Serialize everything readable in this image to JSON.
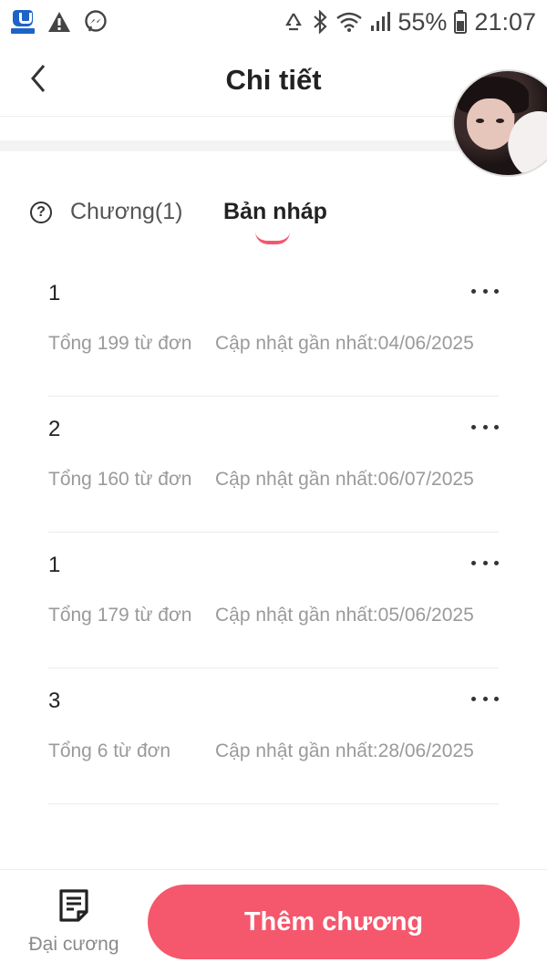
{
  "status_bar": {
    "battery": "55%",
    "time": "21:07",
    "icons": [
      "app-notification-icon",
      "warning-icon",
      "messenger-icon",
      "recycle-icon",
      "bluetooth-icon",
      "wifi-icon",
      "signal-icon",
      "battery-icon"
    ]
  },
  "header": {
    "title": "Chi tiết",
    "back_icon": "chevron-left-icon"
  },
  "tabs": {
    "chapters_label": "Chương(1)",
    "drafts_label": "Bản nháp",
    "active": "drafts",
    "help_icon": "question-circle-icon"
  },
  "drafts": [
    {
      "title": "1",
      "words": "Tổng 199 từ đơn",
      "updated": "Cập nhật gần nhất:04/06/2025"
    },
    {
      "title": "2",
      "words": "Tổng 160 từ đơn",
      "updated": "Cập nhật gần nhất:06/07/2025"
    },
    {
      "title": "1",
      "words": "Tổng 179 từ đơn",
      "updated": "Cập nhật gần nhất:05/06/2025"
    },
    {
      "title": "3",
      "words": "Tổng 6 từ đơn",
      "updated": "Cập nhật gần nhất:28/06/2025"
    }
  ],
  "bottom_bar": {
    "outline_label": "Đại cương",
    "outline_icon": "note-icon",
    "add_chapter_label": "Thêm chương"
  },
  "colors": {
    "accent": "#f5576c",
    "secondary_text": "#9a9a9a"
  }
}
